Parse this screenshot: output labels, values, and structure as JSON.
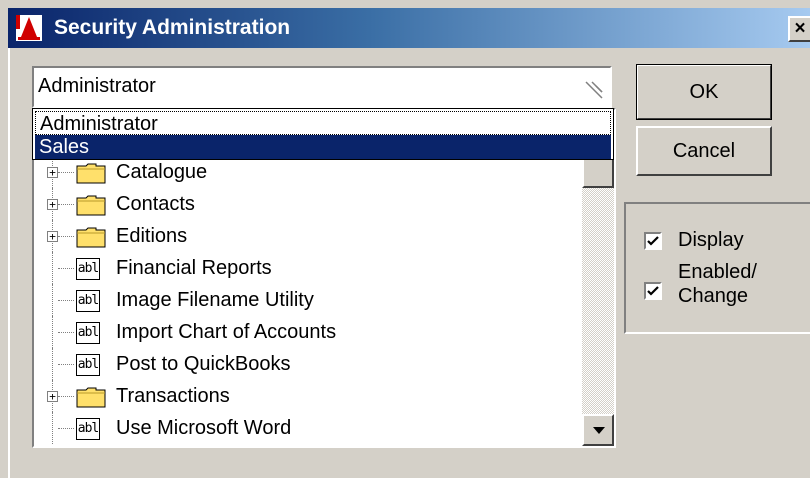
{
  "window": {
    "title": "Security Administration",
    "close_label": "×",
    "app_icon": "app-logo-icon"
  },
  "combo": {
    "value": "Administrator",
    "options": [
      "Administrator",
      "Sales"
    ],
    "highlighted": "Sales"
  },
  "tree": {
    "rows": [
      {
        "label": "Catalogue",
        "type": "folder",
        "expandable": true
      },
      {
        "label": "Contacts",
        "type": "folder",
        "expandable": true
      },
      {
        "label": "Editions",
        "type": "folder",
        "expandable": true
      },
      {
        "label": "Financial Reports",
        "type": "form",
        "expandable": false
      },
      {
        "label": "Image Filename Utility",
        "type": "form",
        "expandable": false
      },
      {
        "label": "Import Chart of Accounts",
        "type": "form",
        "expandable": false
      },
      {
        "label": "Post to QuickBooks",
        "type": "form",
        "expandable": false
      },
      {
        "label": "Transactions",
        "type": "folder",
        "expandable": true
      },
      {
        "label": "Use Microsoft Word",
        "type": "form",
        "expandable": false
      }
    ],
    "expander_symbol": "+",
    "form_icon_text": "abl"
  },
  "buttons": {
    "ok_label": "OK",
    "cancel_label": "Cancel"
  },
  "permissions": {
    "display_label": "Display",
    "display_checked": true,
    "enabled_label": "Enabled/ Change",
    "enabled_checked": true
  },
  "colors": {
    "title_bar": "#0a246a",
    "selection": "#0a246a",
    "face": "#d4d0c8"
  }
}
